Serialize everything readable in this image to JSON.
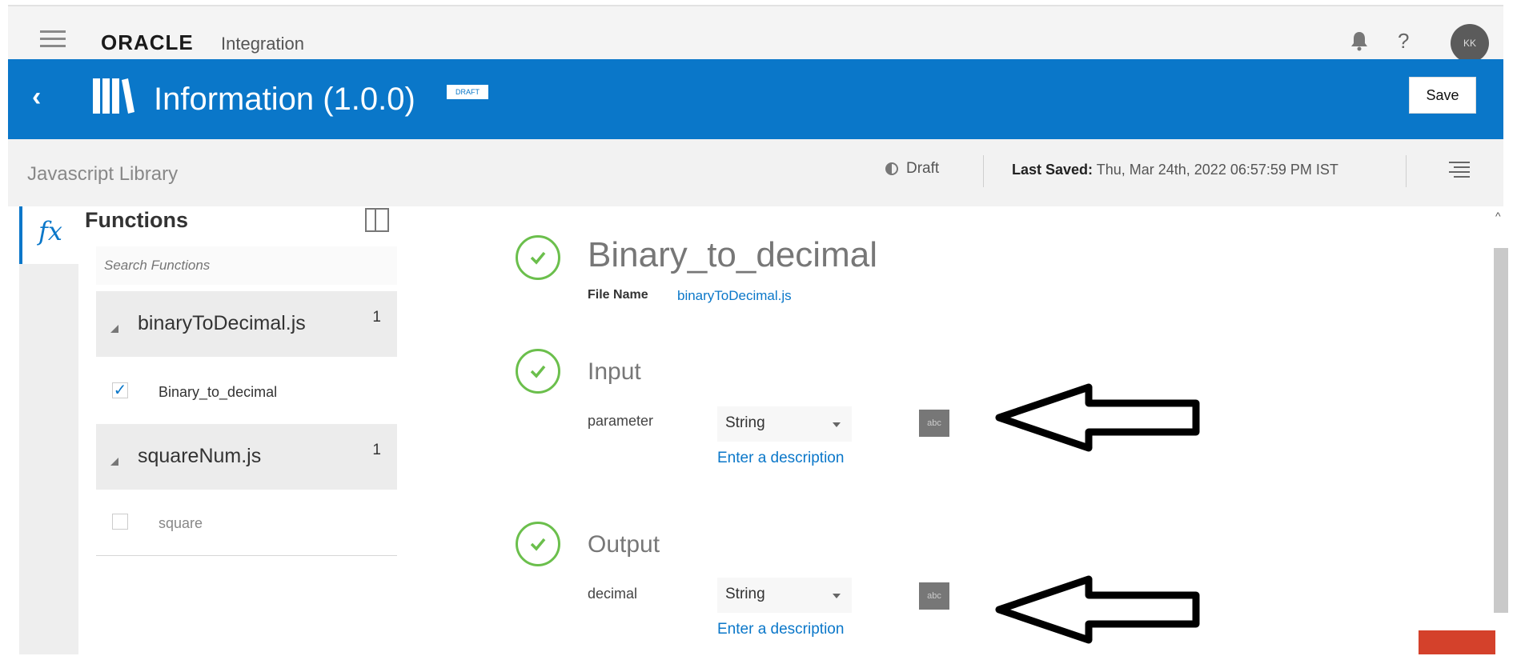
{
  "app": {
    "brand": "ORACLE",
    "product": "Integration",
    "avatar_initials": "KK"
  },
  "header": {
    "title": "Information (1.0.0)",
    "badge": "DRAFT",
    "save_label": "Save"
  },
  "subheader": {
    "library_type": "Javascript Library",
    "status": "Draft",
    "last_saved_label": "Last Saved:",
    "last_saved_value": "Thu, Mar 24th, 2022 06:57:59 PM IST"
  },
  "sidebar": {
    "title": "Functions",
    "search_placeholder": "Search Functions",
    "files": [
      {
        "name": "binaryToDecimal.js",
        "count": "1",
        "functions": [
          {
            "name": "Binary_to_decimal",
            "checked": true
          }
        ]
      },
      {
        "name": "squareNum.js",
        "count": "1",
        "functions": [
          {
            "name": "square",
            "checked": false
          }
        ]
      }
    ]
  },
  "main": {
    "function_name": "Binary_to_decimal",
    "file_name_label": "File Name",
    "file_name_value": "binaryToDecimal.js",
    "input": {
      "title": "Input",
      "param_name": "parameter",
      "type": "String",
      "type_icon": "abc",
      "description_link": "Enter a description"
    },
    "output": {
      "title": "Output",
      "param_name": "decimal",
      "type": "String",
      "type_icon": "abc",
      "description_link": "Enter a description"
    }
  },
  "colors": {
    "header_blue": "#0a77c9",
    "success_green": "#6bbf4c",
    "alert_red": "#d4412b"
  },
  "icons": [
    "hamburger-icon",
    "bell-icon",
    "help-icon",
    "back-icon",
    "library-icon",
    "fx-icon",
    "panel-toggle-icon",
    "check-circle-icon",
    "abc-type-icon",
    "menu-icon",
    "arrow-annotation"
  ]
}
